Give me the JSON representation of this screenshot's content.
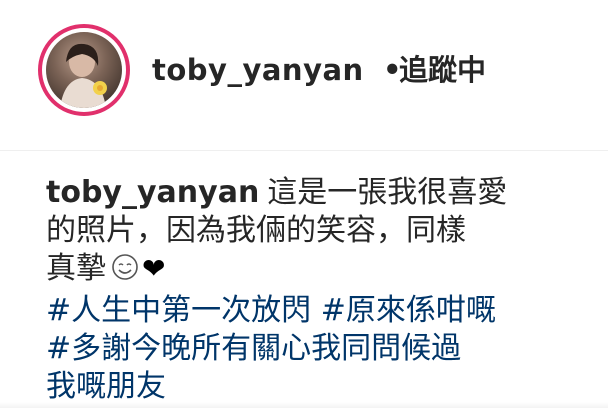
{
  "post_header": {
    "username": "toby_yanyan",
    "separator": "•",
    "follow_status": "追蹤中"
  },
  "caption": {
    "username": "toby_yanyan",
    "text_line1": "這是一張我很喜愛",
    "text_line2": "的照片，因為我倆的笑容，同樣",
    "text_line3": "真摯",
    "emoji_icon": "smiling-face-icon",
    "heart": "❤",
    "hashtags": [
      "#人生中第一次放閃",
      "#原來係咁嘅",
      "#多謝今晚所有關心我同問候過",
      "我嘅朋友"
    ]
  },
  "colors": {
    "text": "#262626",
    "hashtag": "#003569",
    "story_ring": "#e1306c"
  }
}
